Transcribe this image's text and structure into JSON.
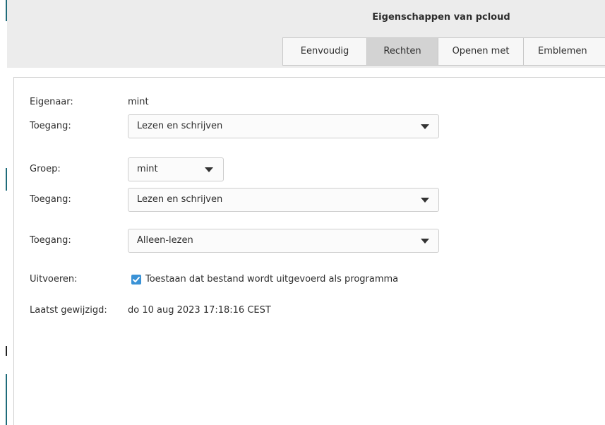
{
  "window": {
    "title": "Eigenschappen van pcloud"
  },
  "tabs": [
    {
      "label": "Eenvoudig",
      "active": false
    },
    {
      "label": "Rechten",
      "active": true
    },
    {
      "label": "Openen met",
      "active": false
    },
    {
      "label": "Emblemen",
      "active": false
    }
  ],
  "permissions": {
    "owner_label": "Eigenaar:",
    "owner_value": "mint",
    "owner_access_label": "Toegang:",
    "owner_access_value": "Lezen en schrijven",
    "group_label": "Groep:",
    "group_value": "mint",
    "group_access_label": "Toegang:",
    "group_access_value": "Lezen en schrijven",
    "others_access_label": "Toegang:",
    "others_access_value": "Alleen-lezen",
    "execute_label": "Uitvoeren:",
    "execute_checkbox_label": "Toestaan dat bestand wordt uitgevoerd als programma",
    "execute_checked": true,
    "modified_label": "Laatst gewijzigd:",
    "modified_value": "do 10 aug 2023 17:18:16 CEST"
  },
  "icons": {
    "dropdown": "chevron-down-icon",
    "checkbox": "check-icon"
  },
  "colors": {
    "accent": "#3a92d6",
    "active_tab": "#d3d3d3",
    "titlebar": "#ececec"
  }
}
